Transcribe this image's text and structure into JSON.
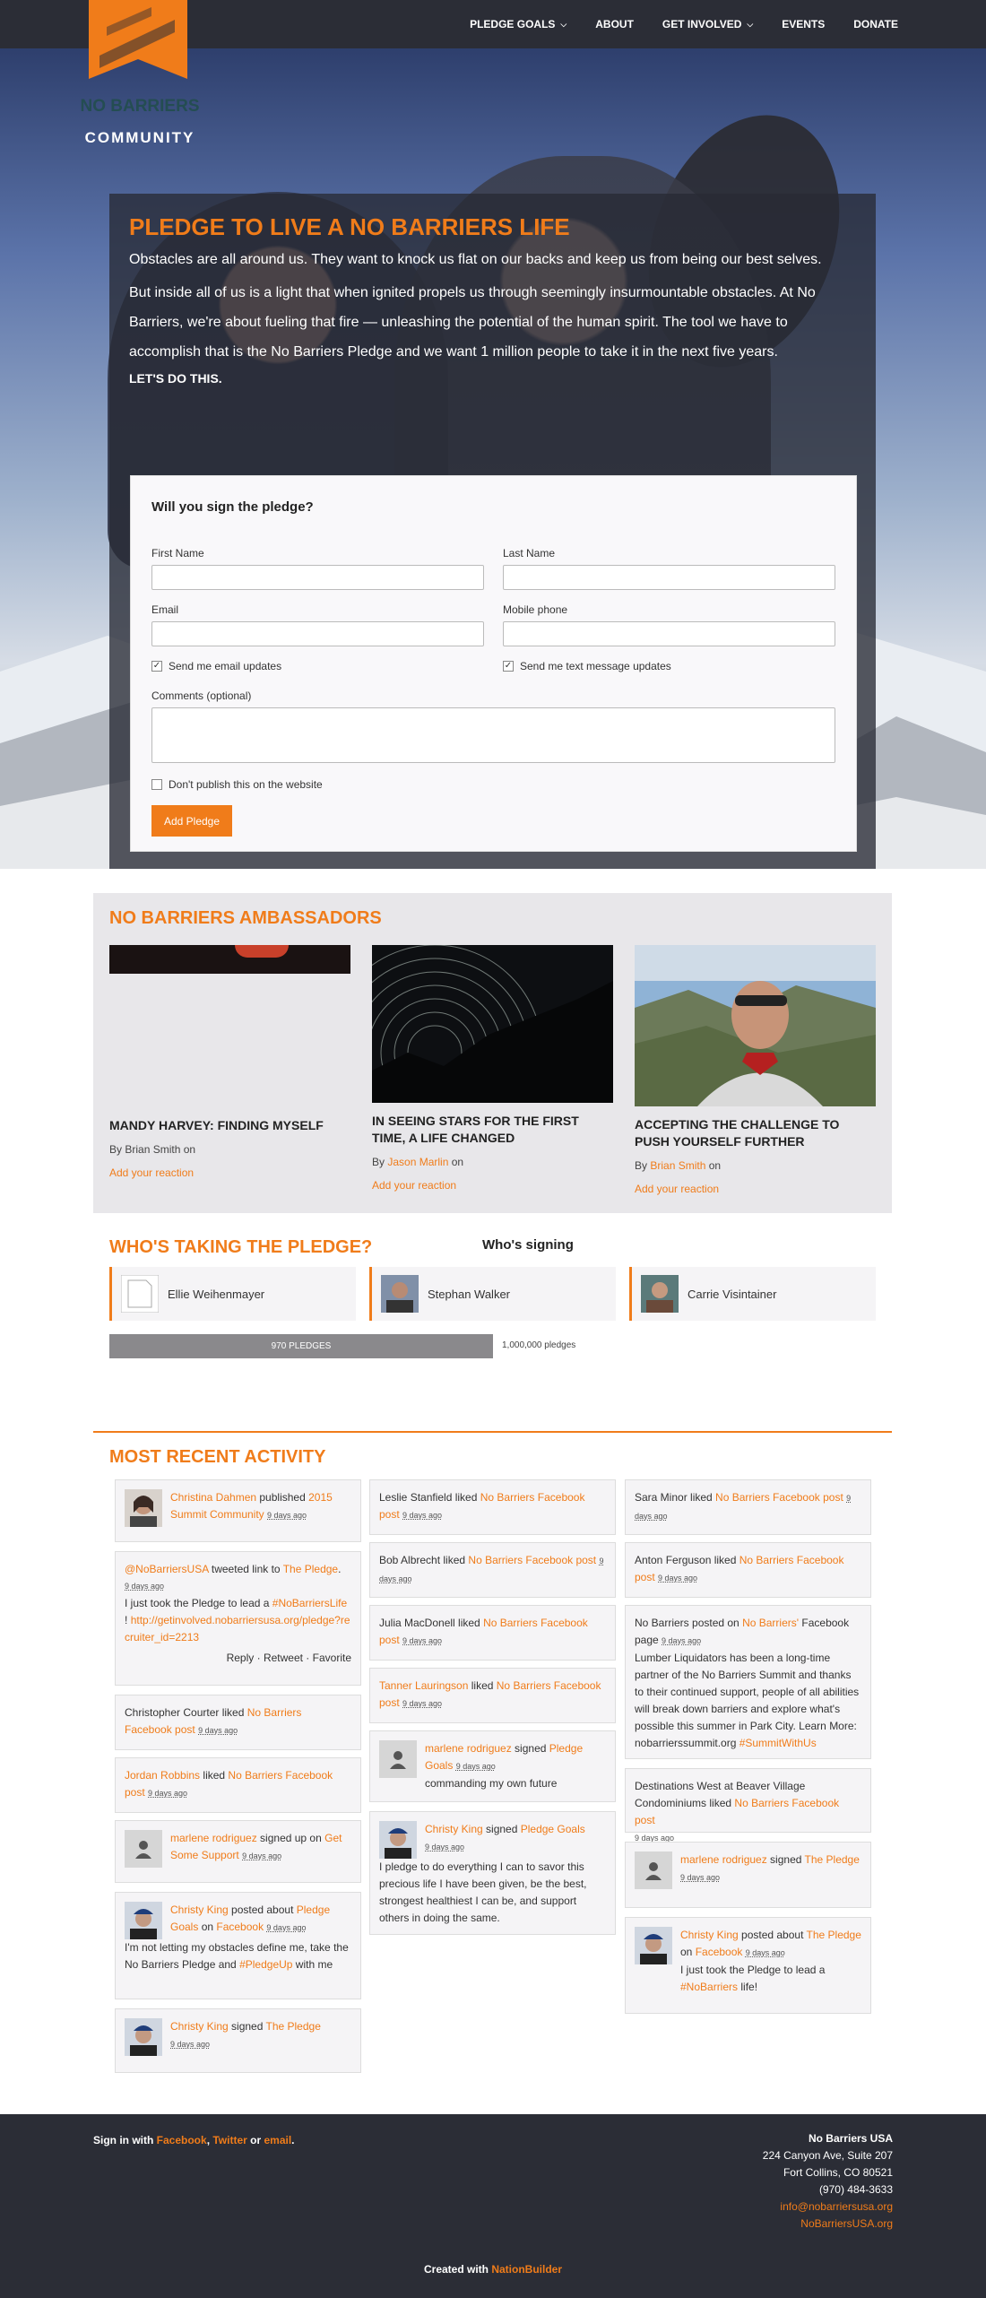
{
  "brand": {
    "name_line1": "NO BARRIERS",
    "name_line2": "COMMUNITY",
    "accent": "#f07c1a",
    "dark": "#2b2d36"
  },
  "nav": [
    {
      "label": "PLEDGE GOALS",
      "has_menu": true
    },
    {
      "label": "ABOUT",
      "has_menu": false
    },
    {
      "label": "GET INVOLVED",
      "has_menu": true
    },
    {
      "label": "EVENTS",
      "has_menu": false
    },
    {
      "label": "DONATE",
      "has_menu": false
    }
  ],
  "hero": {
    "title": "PLEDGE TO LIVE A NO BARRIERS LIFE",
    "p1": "Obstacles are all around us. They want to knock us flat on our backs and keep us from being our best selves.",
    "p2": "But inside all of us is a light that when ignited propels us through seemingly insurmountable obstacles. At No Barriers, we're about fueling that fire — unleashing the potential of the human spirit. The tool we have to accomplish that is the No Barriers Pledge and we want 1 million people to take it in the next five years.",
    "cta": "LET'S DO THIS."
  },
  "form": {
    "heading": "Will you sign the pledge?",
    "first_name": "First Name",
    "last_name": "Last Name",
    "email": "Email",
    "mobile": "Mobile phone",
    "email_updates": "Send me email updates",
    "text_updates": "Send me text message updates",
    "comments": "Comments (optional)",
    "dont_publish": "Don't publish this on the website",
    "submit": "Add Pledge"
  },
  "ambassadors": {
    "heading": "NO BARRIERS AMBASSADORS",
    "cards": [
      {
        "title": "MANDY HARVEY: FINDING MYSELF",
        "by": "By",
        "author": "Brian Smith",
        "on": "on",
        "reaction": "Add your reaction"
      },
      {
        "title": "IN SEEING STARS FOR THE FIRST TIME, A LIFE CHANGED",
        "by": "By",
        "author": "Jason Marlin",
        "on": "on",
        "reaction": "Add your reaction"
      },
      {
        "title": "ACCEPTING THE CHALLENGE TO PUSH YOURSELF FURTHER",
        "by": "By",
        "author": "Brian Smith",
        "on": "on",
        "reaction": "Add your reaction"
      }
    ]
  },
  "who": {
    "heading": "WHO'S TAKING THE PLEDGE?",
    "signing": "Who's signing",
    "signers": [
      "Ellie Weihenmayer",
      "Stephan Walker",
      "Carrie Visintainer"
    ],
    "progress_label": "970 PLEDGES",
    "progress_fraction": 0.00097,
    "goal": "1,000,000 pledges"
  },
  "activity": {
    "heading": "MOST RECENT ACTIVITY",
    "col1": {
      "a1": {
        "name": "Christina Dahmen",
        "verb": " published ",
        "obj": "2015 Summit Community",
        "ts": "9 days ago"
      },
      "a2": {
        "handle": "@NoBarriersUSA",
        "verb": " tweeted link to ",
        "obj": "The Pledge",
        "ts": "9 days ago",
        "text": "I just took the Pledge to lead a ",
        "tag": "#NoBarriersLife",
        "bang": " !",
        "link": "http://getinvolved.nobarriersusa.org/pledge?recruiter_id=2213",
        "reply": "Reply",
        "retweet": "Retweet",
        "favorite": "Favorite"
      },
      "a3": {
        "name": "Christopher Courter",
        "verb": " liked ",
        "obj": "No Barriers Facebook post",
        "ts": "9 days ago"
      },
      "a4": {
        "name": "Jordan Robbins",
        "verb": " liked ",
        "obj": "No Barriers Facebook post",
        "ts": "9 days ago"
      },
      "a5": {
        "name": "marlene rodriguez",
        "verb": " signed up on ",
        "obj": "Get Some Support",
        "ts": "9 days ago"
      },
      "a6": {
        "name": "Christy King",
        "verb": " posted about ",
        "obj": "Pledge Goals",
        "on": " on ",
        "via": "Facebook",
        "ts": "9 days ago",
        "text": "I'm not letting my obstacles define me, take the No Barriers Pledge and ",
        "tag": "#PledgeUp",
        "tail": " with me"
      },
      "a7": {
        "name": "Christy King",
        "verb": " signed ",
        "obj": "The Pledge",
        "ts": "9 days ago"
      }
    },
    "col2": {
      "b1": {
        "name": "Leslie Stanfield",
        "verb": " liked ",
        "obj": "No Barriers Facebook post",
        "ts": "9 days ago"
      },
      "b2": {
        "name": "Bob Albrecht",
        "verb": " liked ",
        "obj": "No Barriers Facebook post",
        "ts": "9 days ago"
      },
      "b3": {
        "name": "Julia MacDonell",
        "verb": " liked ",
        "obj": "No Barriers Facebook post",
        "ts": "9 days ago"
      },
      "b4": {
        "name": "Tanner Lauringson",
        "verb": " liked ",
        "obj": "No Barriers Facebook post",
        "ts": "9 days ago"
      },
      "b5": {
        "name": "marlene rodriguez",
        "verb": " signed ",
        "obj": "Pledge Goals",
        "ts": "9 days ago",
        "text": "commanding my own future"
      },
      "b6": {
        "name": "Christy King",
        "verb": " signed ",
        "obj": "Pledge Goals",
        "ts": "9 days ago",
        "text": "I pledge to do everything I can to savor this precious life I have been given, be the best, strongest healthiest I can be, and support others in doing the same."
      }
    },
    "col3": {
      "c1": {
        "name": "Sara Minor",
        "verb": " liked ",
        "obj": "No Barriers Facebook post",
        "ts": "9 days ago"
      },
      "c2": {
        "name": "Anton Ferguson",
        "verb": " liked ",
        "obj": "No Barriers Facebook post",
        "ts": "9 days ago"
      },
      "c3": {
        "name": "No Barriers",
        "verb": " posted on ",
        "obj": "No Barriers'",
        "tail": " Facebook page",
        "ts": "9 days ago",
        "text": "Lumber Liquidators has been a long-time partner of the No Barriers Summit and thanks to their continued support, people of all abilities will break down barriers and explore what's possible this summer in Park City. Learn More: nobarrierssummit.org ",
        "tag": "#SummitWithUs"
      },
      "c4": {
        "name": "Destinations West at Beaver Village Condominiums",
        "verb": " liked ",
        "obj": "No Barriers Facebook post",
        "ts": "9 days ago"
      },
      "c5": {
        "name": "marlene rodriguez",
        "verb": " signed ",
        "obj": "The Pledge",
        "ts": "9 days ago"
      },
      "c6": {
        "name": "Christy King",
        "verb": " posted about ",
        "obj": "The Pledge",
        "on": " on ",
        "via": "Facebook",
        "ts": "9 days ago",
        "text": "I just took the Pledge to lead a ",
        "tag": "#NoBarriers",
        "tail": " life!"
      }
    }
  },
  "footer": {
    "sign_in": "Sign in with ",
    "facebook": "Facebook",
    "comma": ", ",
    "twitter": "Twitter",
    "or": " or ",
    "email": "email",
    "period": ".",
    "org": "No Barriers USA",
    "addr1": "224 Canyon Ave, Suite 207",
    "addr2": "Fort Collins, CO 80521",
    "phone": "(970) 484-3633",
    "email_addr": "info@nobarriersusa.org",
    "site": "NoBarriersUSA.org",
    "created": "Created with ",
    "builder": "NationBuilder"
  }
}
